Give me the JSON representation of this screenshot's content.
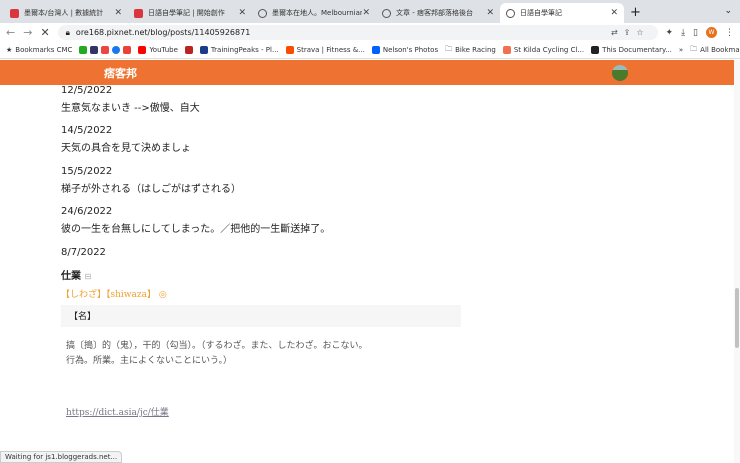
{
  "tabs": [
    {
      "title": "墨爾本/台灣人 | 數據統計",
      "icon": "pixnet-icon"
    },
    {
      "title": "日語自學筆記 | 開始創作",
      "icon": "pixnet-icon"
    },
    {
      "title": "墨爾本在地人。Melbournian - ...",
      "icon": "globe-icon"
    },
    {
      "title": "文章 - 痞客邦部落格後台",
      "icon": "globe-icon"
    },
    {
      "title": "日語自學筆記",
      "icon": "loading-icon",
      "active": true
    }
  ],
  "url": "ore168.pixnet.net/blog/posts/11405926871",
  "profile_initial": "W",
  "bookmarks": [
    "Bookmarks CMC",
    "YouTube",
    "TrainingPeaks - Pl...",
    "Strava | Fitness &...",
    "Nelson's Photos",
    "Bike Racing",
    "St Kilda Cycling Cl...",
    "This Documentary..."
  ],
  "all_bookmarks": "All Bookmarks",
  "site_logo": "痞客邦",
  "entries": [
    {
      "date": "12/5/2022",
      "text": "生意気なまいき -->傲慢、自大"
    },
    {
      "date": "14/5/2022",
      "text": "天気の具合を見て決めましょ"
    },
    {
      "date": "15/5/2022",
      "text": "梯子が外される（はしごがはずされる）"
    },
    {
      "date": "24/6/2022",
      "text": "彼の一生を台無しにしてしまった。／把他的一生斷送掉了。"
    }
  ],
  "last_date": "8/7/2022",
  "dict": {
    "word": "仕業",
    "reading": "【しわざ】【shiwaza】",
    "pos": "【名】",
    "def1": "搞〔搗〕的（鬼），干的（勾当）。（するわざ。また、したわざ。おこない。",
    "def2": "行為。所業。主によくないことにいう。）",
    "link": "https://dict.asia/jc/仕業"
  },
  "status": "Waiting for js1.bloggerads.net..."
}
